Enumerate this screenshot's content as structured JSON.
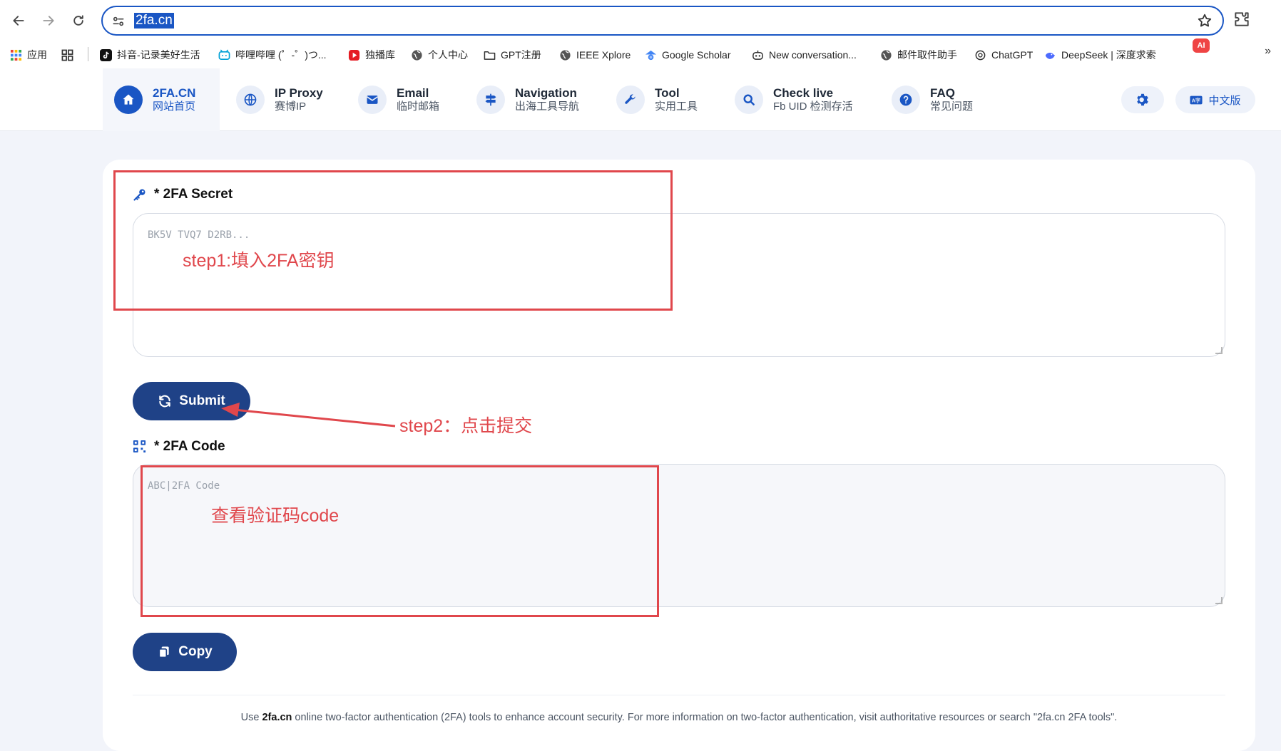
{
  "browser": {
    "url": "2fa.cn",
    "ai_badge": "AI",
    "bookmarks": [
      {
        "label": "应用",
        "icon": "apps-grid-icon"
      },
      {
        "label": "",
        "icon": "tab-groups-icon"
      },
      {
        "label": "抖音-记录美好生活",
        "icon": "tiktok-icon"
      },
      {
        "label": "哔哩哔哩 (゜-゜)つ...",
        "icon": "bilibili-icon"
      },
      {
        "label": "独播库",
        "icon": "play-icon"
      },
      {
        "label": "个人中心",
        "icon": "globe-icon"
      },
      {
        "label": "GPT注册",
        "icon": "folder-icon"
      },
      {
        "label": "IEEE Xplore",
        "icon": "globe-icon"
      },
      {
        "label": "Google Scholar",
        "icon": "scholar-icon"
      },
      {
        "label": "New conversation...",
        "icon": "bot-icon"
      },
      {
        "label": "邮件取件助手",
        "icon": "globe-icon"
      },
      {
        "label": "ChatGPT",
        "icon": "openai-icon"
      },
      {
        "label": "DeepSeek | 深度求索",
        "icon": "deepseek-icon"
      }
    ]
  },
  "header": {
    "nav": [
      {
        "title": "2FA.CN",
        "sub": "网站首页",
        "icon": "home-icon"
      },
      {
        "title": "IP Proxy",
        "sub": "赛博IP",
        "icon": "globe-icon"
      },
      {
        "title": "Email",
        "sub": "临时邮箱",
        "icon": "mail-icon"
      },
      {
        "title": "Navigation",
        "sub": "出海工具导航",
        "icon": "signpost-icon"
      },
      {
        "title": "Tool",
        "sub": "实用工具",
        "icon": "wrench-icon"
      },
      {
        "title": "Check live",
        "sub": "Fb UID 检测存活",
        "icon": "search-icon"
      },
      {
        "title": "FAQ",
        "sub": "常见问题",
        "icon": "question-icon"
      }
    ],
    "language": "中文版"
  },
  "form": {
    "secret_label": "* 2FA Secret",
    "secret_placeholder": "BK5V TVQ7 D2RB...",
    "submit_label": "Submit",
    "code_label": "* 2FA Code",
    "code_placeholder": "ABC|2FA Code",
    "copy_label": "Copy"
  },
  "footer": {
    "prefix": "Use ",
    "brand": "2fa.cn",
    "text": " online two-factor authentication (2FA) tools to enhance account security. For more information on two-factor authentication, visit authoritative resources or search \"2fa.cn 2FA tools\"."
  },
  "annotations": {
    "step1": "step1:填入2FA密钥",
    "step2": "step2：点击提交",
    "step3": "查看验证码code"
  },
  "colors": {
    "accent": "#1a56c4",
    "button": "#1f4287",
    "annotation": "#e0474c"
  }
}
